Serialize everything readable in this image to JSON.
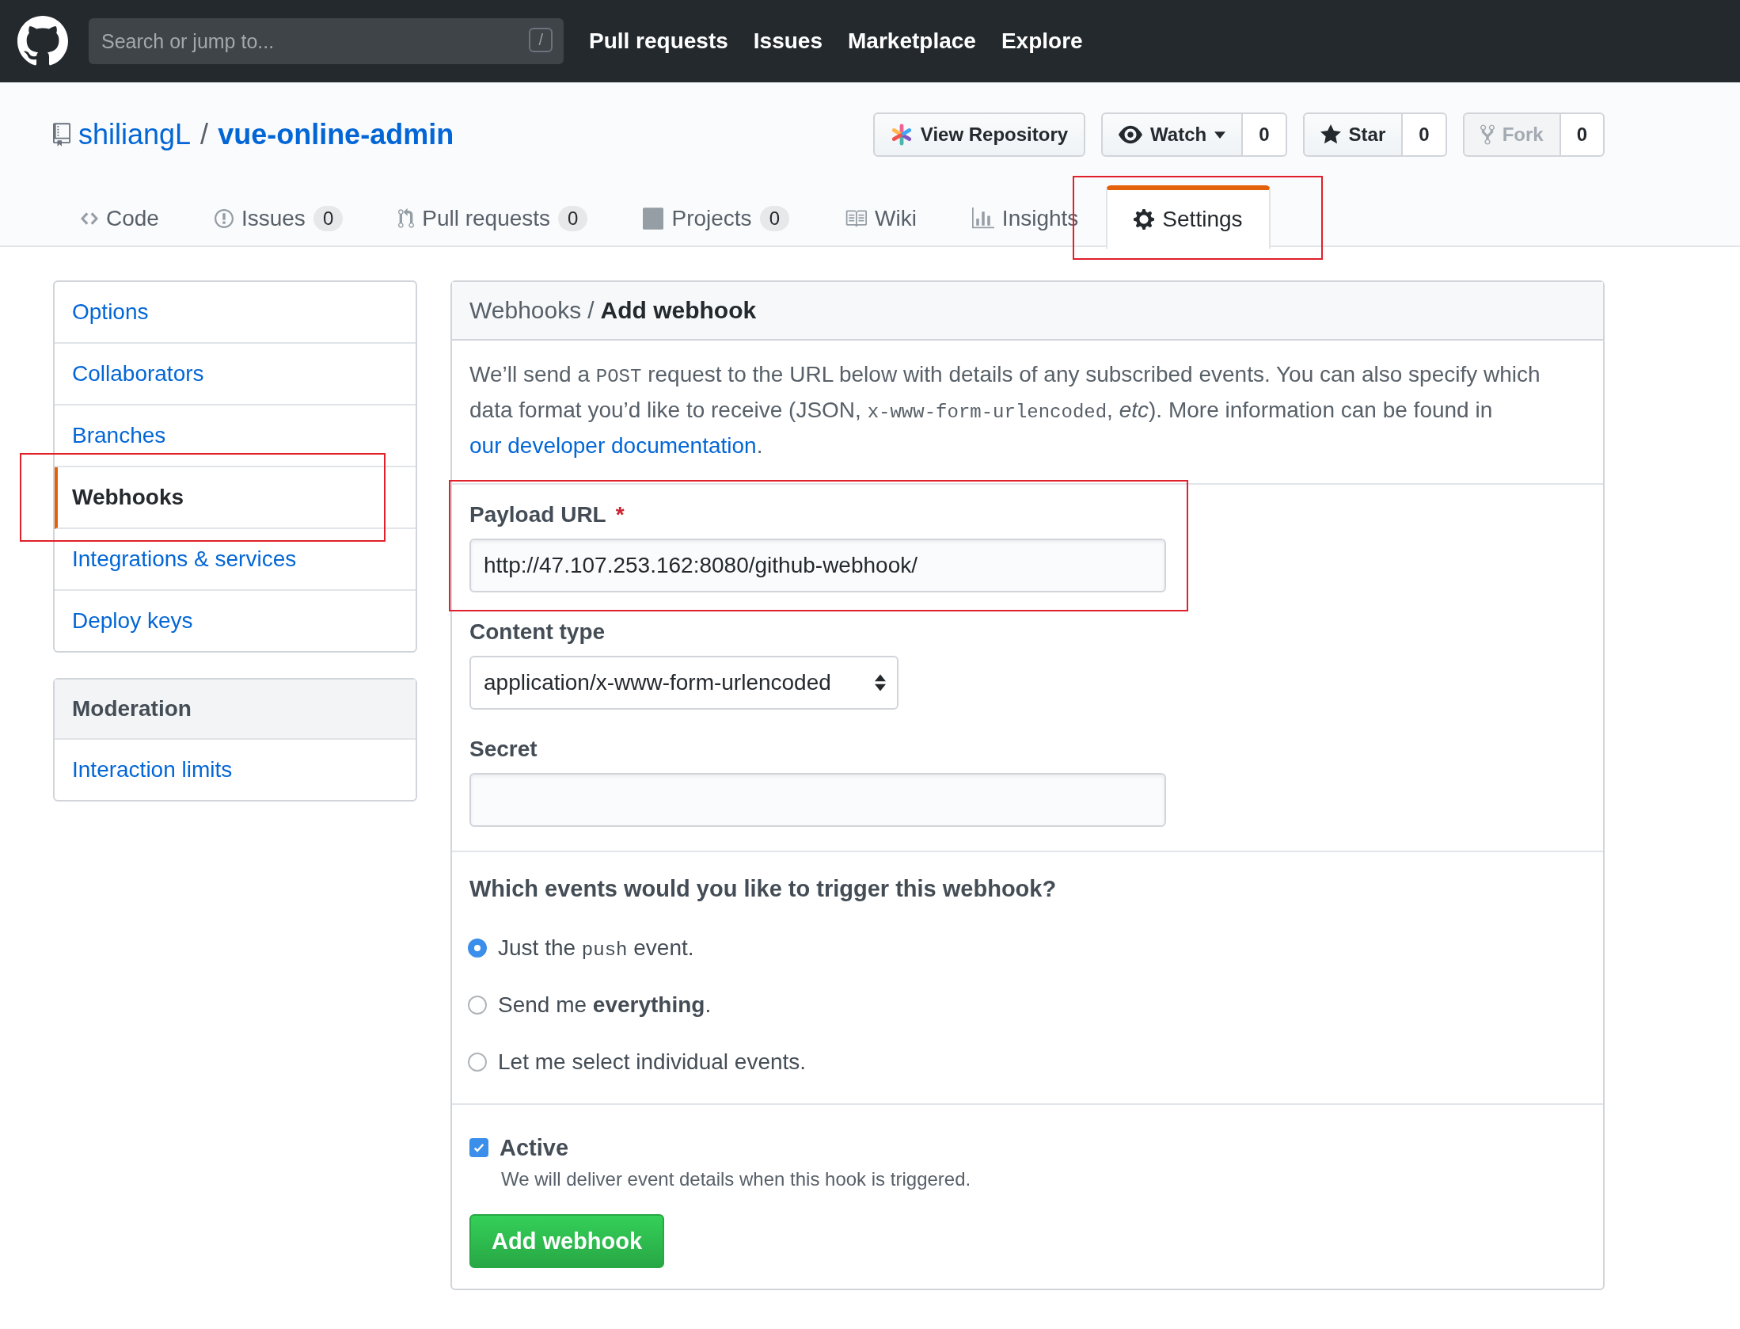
{
  "header": {
    "search_placeholder": "Search or jump to...",
    "search_key": "/",
    "nav": [
      "Pull requests",
      "Issues",
      "Marketplace",
      "Explore"
    ]
  },
  "repo": {
    "owner": "shiliangL",
    "separator": "/",
    "name": "vue-online-admin",
    "actions": [
      {
        "kind": "view",
        "label": "View Repository",
        "disabled": false
      },
      {
        "kind": "watch",
        "label": "Watch",
        "count": "0",
        "disabled": false
      },
      {
        "kind": "star",
        "label": "Star",
        "count": "0",
        "disabled": false
      },
      {
        "kind": "fork",
        "label": "Fork",
        "count": "0",
        "disabled": true
      }
    ]
  },
  "tabs": [
    {
      "kind": "code",
      "label": "Code",
      "selected": false,
      "highlighted": false
    },
    {
      "kind": "issues",
      "label": "Issues",
      "count": "0",
      "selected": false,
      "highlighted": false
    },
    {
      "kind": "pulls",
      "label": "Pull requests",
      "count": "0",
      "selected": false,
      "highlighted": false
    },
    {
      "kind": "projects",
      "label": "Projects",
      "count": "0",
      "selected": false,
      "highlighted": false
    },
    {
      "kind": "wiki",
      "label": "Wiki",
      "selected": false,
      "highlighted": false
    },
    {
      "kind": "insights",
      "label": "Insights",
      "selected": false,
      "highlighted": false
    },
    {
      "kind": "settings",
      "label": "Settings",
      "selected": true,
      "highlighted": true
    }
  ],
  "sidebar": [
    {
      "items": [
        {
          "label": "Options",
          "selected": false,
          "highlighted": false
        },
        {
          "label": "Collaborators",
          "selected": false,
          "highlighted": false
        },
        {
          "label": "Branches",
          "selected": false,
          "highlighted": false
        },
        {
          "label": "Webhooks",
          "selected": true,
          "highlighted": true
        },
        {
          "label": "Integrations & services",
          "selected": false,
          "highlighted": false
        },
        {
          "label": "Deploy keys",
          "selected": false,
          "highlighted": false
        }
      ]
    },
    {
      "heading": "Moderation",
      "items": [
        {
          "label": "Interaction limits",
          "selected": false,
          "highlighted": false
        }
      ]
    }
  ],
  "panel": {
    "breadcrumb": {
      "parent": "Webhooks",
      "separator": "/",
      "current": "Add webhook"
    },
    "intro": [
      {
        "kind": "text",
        "text": "We’ll send a "
      },
      {
        "kind": "code",
        "text": "POST"
      },
      {
        "kind": "text",
        "text": " request to the URL below with details of any subscribed events. You can also specify which data format you’d like to receive (JSON, "
      },
      {
        "kind": "code",
        "text": "x-www-form-urlencoded"
      },
      {
        "kind": "text",
        "text": ", "
      },
      {
        "kind": "em",
        "text": "etc"
      },
      {
        "kind": "text",
        "text": "). More information can be found in "
      },
      {
        "kind": "link",
        "text": "our developer documentation"
      },
      {
        "kind": "text",
        "text": "."
      }
    ],
    "payload_url": {
      "label": "Payload URL",
      "required_mark": "*",
      "value": "http://47.107.253.162:8080/github-webhook/",
      "highlighted": true
    },
    "content_type": {
      "label": "Content type",
      "value": "application/x-www-form-urlencoded"
    },
    "secret": {
      "label": "Secret"
    },
    "events": {
      "question": "Which events would you like to trigger this webhook?",
      "options": [
        {
          "selected": true,
          "parts": [
            {
              "kind": "text",
              "text": "Just the "
            },
            {
              "kind": "code",
              "text": "push"
            },
            {
              "kind": "text",
              "text": " event."
            }
          ]
        },
        {
          "selected": false,
          "parts": [
            {
              "kind": "text",
              "text": "Send me "
            },
            {
              "kind": "strong",
              "text": "everything"
            },
            {
              "kind": "text",
              "text": "."
            }
          ]
        },
        {
          "selected": false,
          "parts": [
            {
              "kind": "text",
              "text": "Let me select individual events."
            }
          ]
        }
      ]
    },
    "active": {
      "label": "Active",
      "checked": true,
      "hint": "We will deliver event details when this hook is triggered."
    },
    "submit": "Add webhook"
  }
}
